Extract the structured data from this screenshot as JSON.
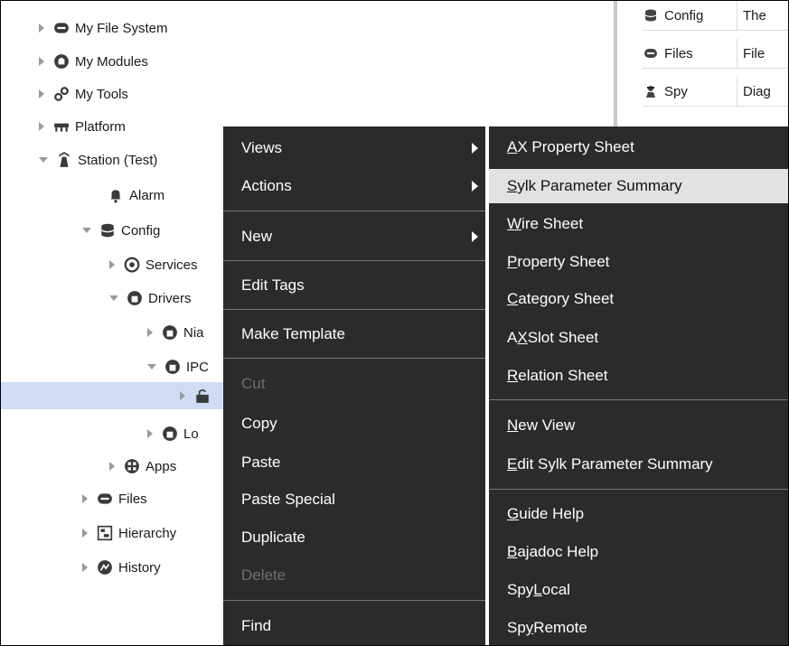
{
  "tree": [
    {
      "id": "my-file-system",
      "label": "My File System",
      "icon": "drive-icon",
      "expanded": false
    },
    {
      "id": "my-modules",
      "label": "My Modules",
      "icon": "modules-icon",
      "expanded": false
    },
    {
      "id": "my-tools",
      "label": "My Tools",
      "icon": "tools-icon",
      "expanded": false
    },
    {
      "id": "platform",
      "label": "Platform",
      "icon": "platform-icon",
      "expanded": false
    },
    {
      "id": "station",
      "label": "Station (Test)",
      "icon": "station-icon",
      "expanded": true
    },
    {
      "id": "alarm",
      "label": "Alarm",
      "icon": "bell-icon"
    },
    {
      "id": "config",
      "label": "Config",
      "icon": "database-icon",
      "expanded": true
    },
    {
      "id": "services",
      "label": "Services",
      "icon": "services-icon",
      "expanded": false
    },
    {
      "id": "drivers",
      "label": "Drivers",
      "icon": "drivers-icon",
      "expanded": true
    },
    {
      "id": "nia",
      "label": "Nia",
      "icon": "network-icon",
      "expanded": false
    },
    {
      "id": "ipc",
      "label": "IPC",
      "icon": "network-icon",
      "expanded": true
    },
    {
      "id": "selected-device",
      "label": "",
      "icon": "device-icon",
      "expanded": false,
      "selected": true
    },
    {
      "id": "lo",
      "label": "Lo",
      "icon": "network-icon",
      "expanded": false
    },
    {
      "id": "apps",
      "label": "Apps",
      "icon": "apps-icon",
      "expanded": false
    },
    {
      "id": "files",
      "label": "Files",
      "icon": "drive-icon",
      "expanded": false
    },
    {
      "id": "hierarchy",
      "label": "Hierarchy",
      "icon": "hierarchy-icon",
      "expanded": false
    },
    {
      "id": "history",
      "label": "History",
      "icon": "history-icon",
      "expanded": false
    }
  ],
  "table": {
    "rows": [
      {
        "name": "Config",
        "desc": "The",
        "icon": "database-icon"
      },
      {
        "name": "Files",
        "desc": "File",
        "icon": "drive-icon"
      },
      {
        "name": "Spy",
        "desc": "Diag",
        "icon": "spy-icon"
      }
    ]
  },
  "context_menu": {
    "items": [
      {
        "label": "Views",
        "submenu": true
      },
      {
        "label": "Actions",
        "submenu": true
      },
      {
        "label": "New",
        "submenu": true
      },
      {
        "label": "Edit Tags"
      },
      {
        "label": "Make Template"
      },
      {
        "label": "Cut",
        "disabled": true
      },
      {
        "label": "Copy"
      },
      {
        "label": "Paste"
      },
      {
        "label": "Paste Special"
      },
      {
        "label": "Duplicate"
      },
      {
        "label": "Delete",
        "disabled": true
      },
      {
        "label": "Find"
      }
    ]
  },
  "views_submenu": {
    "items": [
      {
        "pre": "",
        "u": "A",
        "post": "X Property Sheet"
      },
      {
        "pre": "",
        "u": "S",
        "post": "ylk Parameter Summary",
        "highlighted": true
      },
      {
        "pre": "",
        "u": "W",
        "post": "ire Sheet"
      },
      {
        "pre": "",
        "u": "P",
        "post": "roperty Sheet"
      },
      {
        "pre": "",
        "u": "C",
        "post": "ategory Sheet"
      },
      {
        "pre": "A",
        "u": "X",
        "post": " Slot Sheet"
      },
      {
        "pre": "",
        "u": "R",
        "post": "elation Sheet"
      },
      {
        "pre": "",
        "u": "N",
        "post": "ew View"
      },
      {
        "pre": "",
        "u": "E",
        "post": "dit Sylk Parameter Summary"
      },
      {
        "pre": "",
        "u": "G",
        "post": "uide Help"
      },
      {
        "pre": "",
        "u": "B",
        "post": "ajadoc Help"
      },
      {
        "pre": "Spy ",
        "u": "L",
        "post": "ocal"
      },
      {
        "pre": "Sp",
        "u": "y",
        "post": " Remote"
      }
    ]
  },
  "colors": {
    "menu_bg": "#2b2b2b",
    "highlight": "#e2e2e2",
    "selection": "#cfdcf4"
  }
}
